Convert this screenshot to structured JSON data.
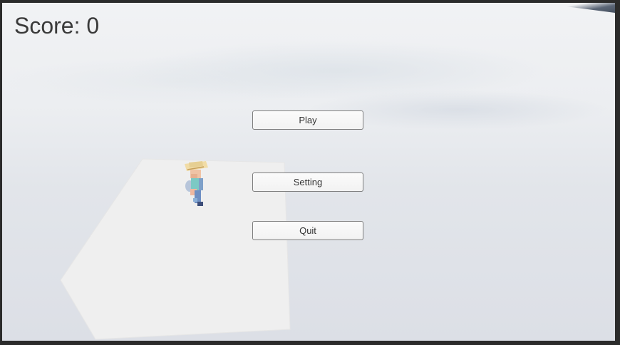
{
  "hud": {
    "score_label": "Score: 0"
  },
  "menu": {
    "play_label": "Play",
    "setting_label": "Setting",
    "quit_label": "Quit"
  },
  "scene": {
    "sky_color": "#eceef1",
    "platform_color": "#efefef",
    "character": "voxel-farmer-with-straw-hat"
  }
}
